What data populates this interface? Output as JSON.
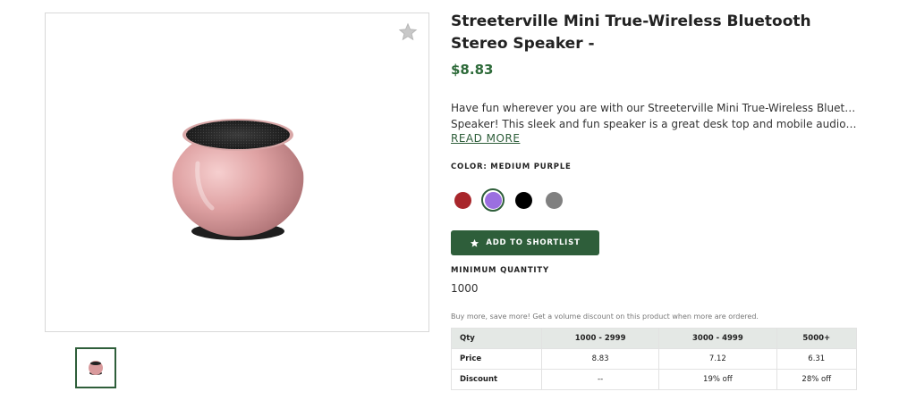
{
  "product": {
    "title": "Streeterville Mini True-Wireless Bluetooth Stereo Speaker -",
    "price": "$8.83",
    "description_line1": "Have fun wherever you are with our Streeterville Mini True-Wireless Bluetooth Stereo",
    "description_line2": "Speaker! This sleek and fun speaker is a great desk top and mobile audio companio…",
    "read_more": "READ MORE"
  },
  "color": {
    "label": "COLOR: MEDIUM PURPLE",
    "options": [
      {
        "name": "red",
        "hex": "#a8262b",
        "selected": false
      },
      {
        "name": "medium-purple",
        "hex": "#9b6fe0",
        "selected": true
      },
      {
        "name": "black",
        "hex": "#000000",
        "selected": false
      },
      {
        "name": "gray",
        "hex": "#808080",
        "selected": false
      }
    ]
  },
  "actions": {
    "shortlist_label": "ADD TO SHORTLIST"
  },
  "quantity": {
    "label": "MINIMUM QUANTITY",
    "value": "1000"
  },
  "pricing": {
    "note": "Buy more, save more! Get a volume discount on this product when more are ordered.",
    "headers": [
      "Qty",
      "1000 - 2999",
      "3000 - 4999",
      "5000+"
    ],
    "rows": [
      [
        "Price",
        "8.83",
        "7.12",
        "6.31"
      ],
      [
        "Discount",
        "--",
        "19% off",
        "28% off"
      ]
    ]
  },
  "theme": {
    "accent": "#2e5e3a",
    "price_color": "#2e6b3a"
  }
}
